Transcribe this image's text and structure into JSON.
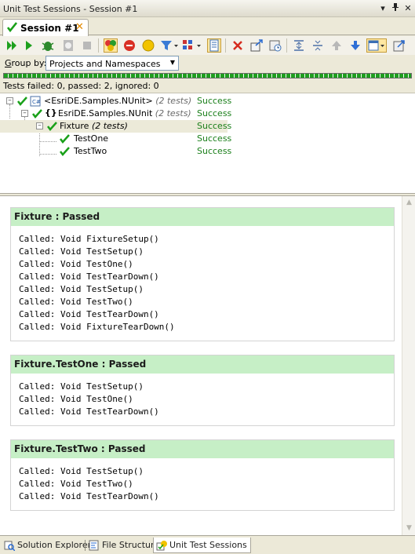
{
  "window": {
    "title": "Unit Test Sessions - Session #1"
  },
  "doc_tab": {
    "label": "Session #1"
  },
  "group_by": {
    "label_prefix": "G",
    "label_rest": "roup by:",
    "selected": "Projects and Namespaces"
  },
  "status_line": "Tests failed: 0, passed: 2, ignored: 0",
  "tree": {
    "project": {
      "label": "<EsriDE.Samples.NUnit>",
      "count": "(2 tests)",
      "result": "Success"
    },
    "namespace": {
      "label": "EsriDE.Samples.NUnit",
      "count": "(2 tests)",
      "result": "Success"
    },
    "fixture": {
      "label": "Fixture",
      "count": "(2 tests)",
      "result": "Success"
    },
    "test_one": {
      "label": "TestOne",
      "result": "Success"
    },
    "test_two": {
      "label": "TestTwo",
      "result": "Success"
    }
  },
  "output": {
    "sections": [
      {
        "title": "Fixture : Passed",
        "lines": [
          "Called: Void FixtureSetup()",
          "Called: Void TestSetup()",
          "Called: Void TestOne()",
          "Called: Void TestTearDown()",
          "Called: Void TestSetup()",
          "Called: Void TestTwo()",
          "Called: Void TestTearDown()",
          "Called: Void FixtureTearDown()"
        ]
      },
      {
        "title": "Fixture.TestOne : Passed",
        "lines": [
          "Called: Void TestSetup()",
          "Called: Void TestOne()",
          "Called: Void TestTearDown()"
        ]
      },
      {
        "title": "Fixture.TestTwo : Passed",
        "lines": [
          "Called: Void TestSetup()",
          "Called: Void TestTwo()",
          "Called: Void TestTearDown()"
        ]
      }
    ]
  },
  "bottom_tabs": [
    {
      "label": "Solution Explorer",
      "icon": "solution-explorer-icon"
    },
    {
      "label": "File Structure",
      "icon": "file-structure-icon"
    },
    {
      "label": "Unit Test Sessions",
      "icon": "unit-test-sessions-icon"
    }
  ],
  "colors": {
    "success": "#1a7f1a",
    "section_header": "#c6efc6",
    "check": "#19a019"
  }
}
